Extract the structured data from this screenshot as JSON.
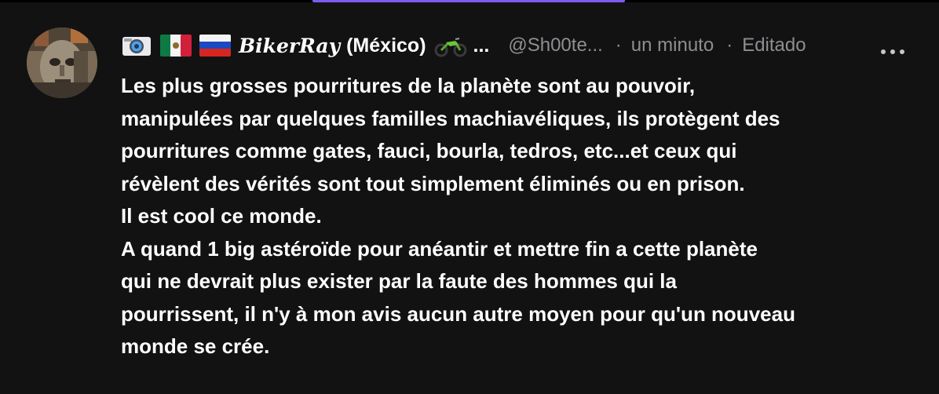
{
  "post": {
    "author": {
      "camera_emoji": "camera-emoji",
      "flags": [
        "mexico-flag",
        "russia-flag"
      ],
      "display_name": "BikerRay",
      "country": "(México)",
      "badge_emoji": "motorcycle-emoji",
      "name_truncation": "...",
      "handle": "@Sh00te...",
      "separator_1": "·",
      "timestamp": "un minuto",
      "separator_2": "·",
      "edited_label": "Editado"
    },
    "more_menu_icon": "more-horizontal-icon",
    "body_lines": [
      "Les plus grosses pourritures de la planète sont au pouvoir,",
      "manipulées par quelques familles machiavéliques, ils protègent des",
      "pourritures comme gates, fauci, bourla, tedros, etc...et ceux qui",
      "révèlent des vérités sont tout simplement éliminés ou en prison.",
      "Il est cool ce monde.",
      "A quand 1 big astéroïde pour anéantir et mettre fin a cette planète",
      "qui ne devrait plus exister par la faute des hommes qui la",
      "pourrissent, il n'y à mon avis aucun autre moyen pour qu'un nouveau",
      "monde se crée."
    ]
  },
  "colors": {
    "background": "#121212",
    "accent": "#7c5cf0",
    "text_primary": "#ffffff",
    "text_secondary": "#8e8e93"
  }
}
